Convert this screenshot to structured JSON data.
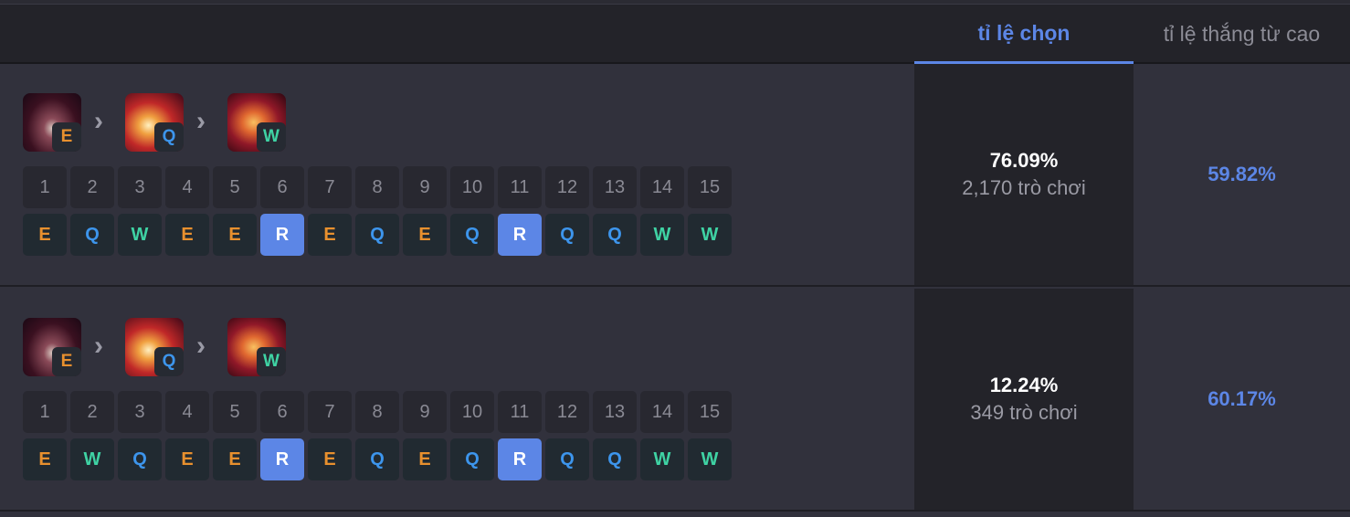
{
  "header": {
    "tabs": [
      {
        "label": "tỉ lệ chọn",
        "active": true
      },
      {
        "label": "tỉ lệ thắng từ cao",
        "active": false
      }
    ]
  },
  "colors": {
    "accent": "#5c86e6",
    "E": "#e8902e",
    "Q": "#3d95ec",
    "W": "#3fd3a4"
  },
  "levels": [
    "1",
    "2",
    "3",
    "4",
    "5",
    "6",
    "7",
    "8",
    "9",
    "10",
    "11",
    "12",
    "13",
    "14",
    "15"
  ],
  "rows": [
    {
      "order": [
        "E",
        "Q",
        "W"
      ],
      "sequence": [
        "E",
        "Q",
        "W",
        "E",
        "E",
        "R",
        "E",
        "Q",
        "E",
        "Q",
        "R",
        "Q",
        "Q",
        "W",
        "W"
      ],
      "pick_rate": "76.09%",
      "games": "2,170 trò chơi",
      "win_rate": "59.82%"
    },
    {
      "order": [
        "E",
        "Q",
        "W"
      ],
      "sequence": [
        "E",
        "W",
        "Q",
        "E",
        "E",
        "R",
        "E",
        "Q",
        "E",
        "Q",
        "R",
        "Q",
        "Q",
        "W",
        "W"
      ],
      "pick_rate": "12.24%",
      "games": "349 trò chơi",
      "win_rate": "60.17%"
    }
  ]
}
